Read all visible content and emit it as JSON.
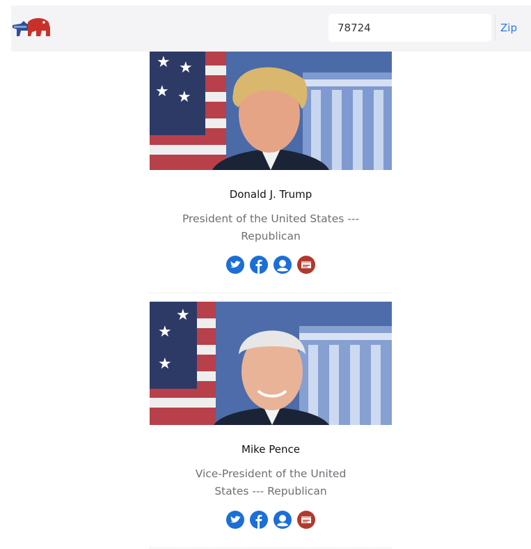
{
  "header": {
    "logo": "elephant-donkey-logo",
    "zip_value": "78724",
    "zip_button_label": "Zip"
  },
  "officials": [
    {
      "name": "Donald J. Trump",
      "title": "President of the United States --- Republican",
      "photo": "portrait-photo"
    },
    {
      "name": "Mike Pence",
      "title": "Vice-President of the United States --- Republican",
      "photo": "portrait-photo"
    }
  ],
  "social_icons": [
    "twitter-icon",
    "facebook-icon",
    "person-icon",
    "website-icon"
  ],
  "colors": {
    "header_bg": "#f4f4f6",
    "link_blue": "#2a7ae2",
    "social_blue": "#1b6fd6",
    "website_red": "#b03a2e"
  }
}
